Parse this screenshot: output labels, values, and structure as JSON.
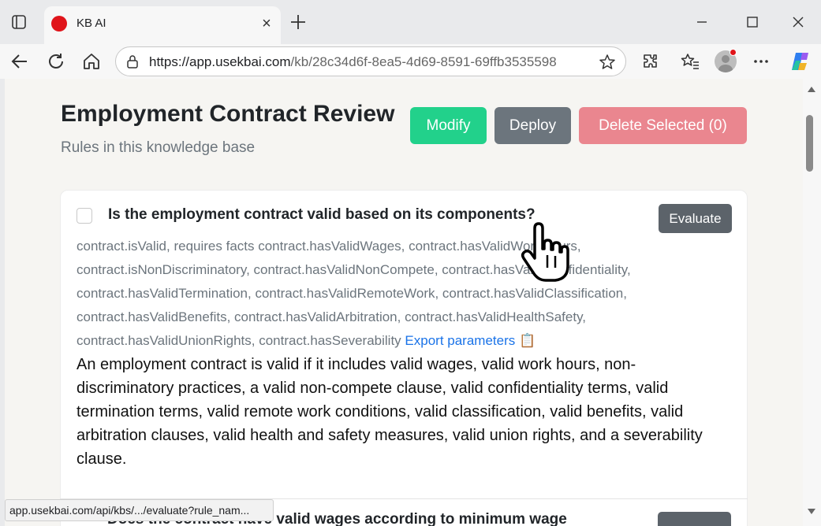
{
  "browser": {
    "tab_title": "KB AI",
    "url_host": "https://app.usekbai.com",
    "url_path": "/kb/28c34d6f-8ea5-4d69-8591-69ffb3535598",
    "status_url": "app.usekbai.com/api/kbs/.../evaluate?rule_nam..."
  },
  "page": {
    "title": "Employment Contract Review",
    "subtitle": "Rules in this knowledge base"
  },
  "actions": {
    "modify_label": "Modify",
    "deploy_label": "Deploy",
    "delete_label": "Delete Selected (0)"
  },
  "rules": [
    {
      "question": "Is the employment contract valid based on its components?",
      "evaluate_label": "Evaluate",
      "facts": "contract.isValid, requires facts contract.hasValidWages, contract.hasValidWorkHours, contract.isNonDiscriminatory, contract.hasValidNonCompete, contract.hasValidConfidentiality, contract.hasValidTermination, contract.hasValidRemoteWork, contract.hasValidClassification, contract.hasValidBenefits, contract.hasValidArbitration, contract.hasValidHealthSafety, contract.hasValidUnionRights, contract.hasSeverability",
      "export_label": "Export parameters",
      "clipboard_glyph": "📋",
      "description": "An employment contract is valid if it includes valid wages, valid work hours, non-discriminatory practices, a valid non-compete clause, valid confidentiality terms, valid termination terms, valid remote work conditions, valid classification, valid benefits, valid arbitration clauses, valid health and safety measures, valid union rights, and a severability clause."
    },
    {
      "question": "Does the contract have valid wages according to minimum wage"
    }
  ],
  "colors": {
    "modify": "#22d18b",
    "deploy": "#6c757d",
    "delete": "#ea868f",
    "link": "#1a73e8"
  }
}
